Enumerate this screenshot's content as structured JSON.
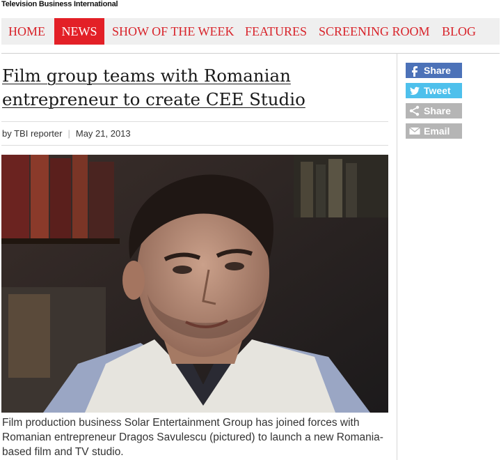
{
  "site": {
    "title": "Television Business International"
  },
  "nav": {
    "items": [
      {
        "label": "HOME"
      },
      {
        "label": "NEWS"
      },
      {
        "label": "SHOW OF THE WEEK"
      },
      {
        "label": "FEATURES"
      },
      {
        "label": "SCREENING ROOM"
      },
      {
        "label": "BLOG"
      }
    ],
    "active": "NEWS"
  },
  "article": {
    "headline": "Film group teams with Romanian entrepreneur to create CEE Studio",
    "author": "by TBI reporter",
    "date": "May 21, 2013",
    "caption": "Film production business Solar Entertainment Group has joined forces with Romanian entrepreneur Dragos Savulescu (pictured) to launch a new Romania-based film and TV studio."
  },
  "share": {
    "facebook": {
      "label": "Share",
      "icon": "facebook-icon",
      "color": "#4c72b8"
    },
    "twitter": {
      "label": "Tweet",
      "icon": "twitter-bird-icon",
      "color": "#4ec0ec"
    },
    "generic": {
      "label": "Share",
      "icon": "share-icon",
      "color": "#b5b5b5"
    },
    "email": {
      "label": "Email",
      "icon": "envelope-icon",
      "color": "#b5b5b5"
    }
  },
  "colors": {
    "accent": "#e32027",
    "nav_text": "#d8232a",
    "nav_bg": "#efefef"
  }
}
